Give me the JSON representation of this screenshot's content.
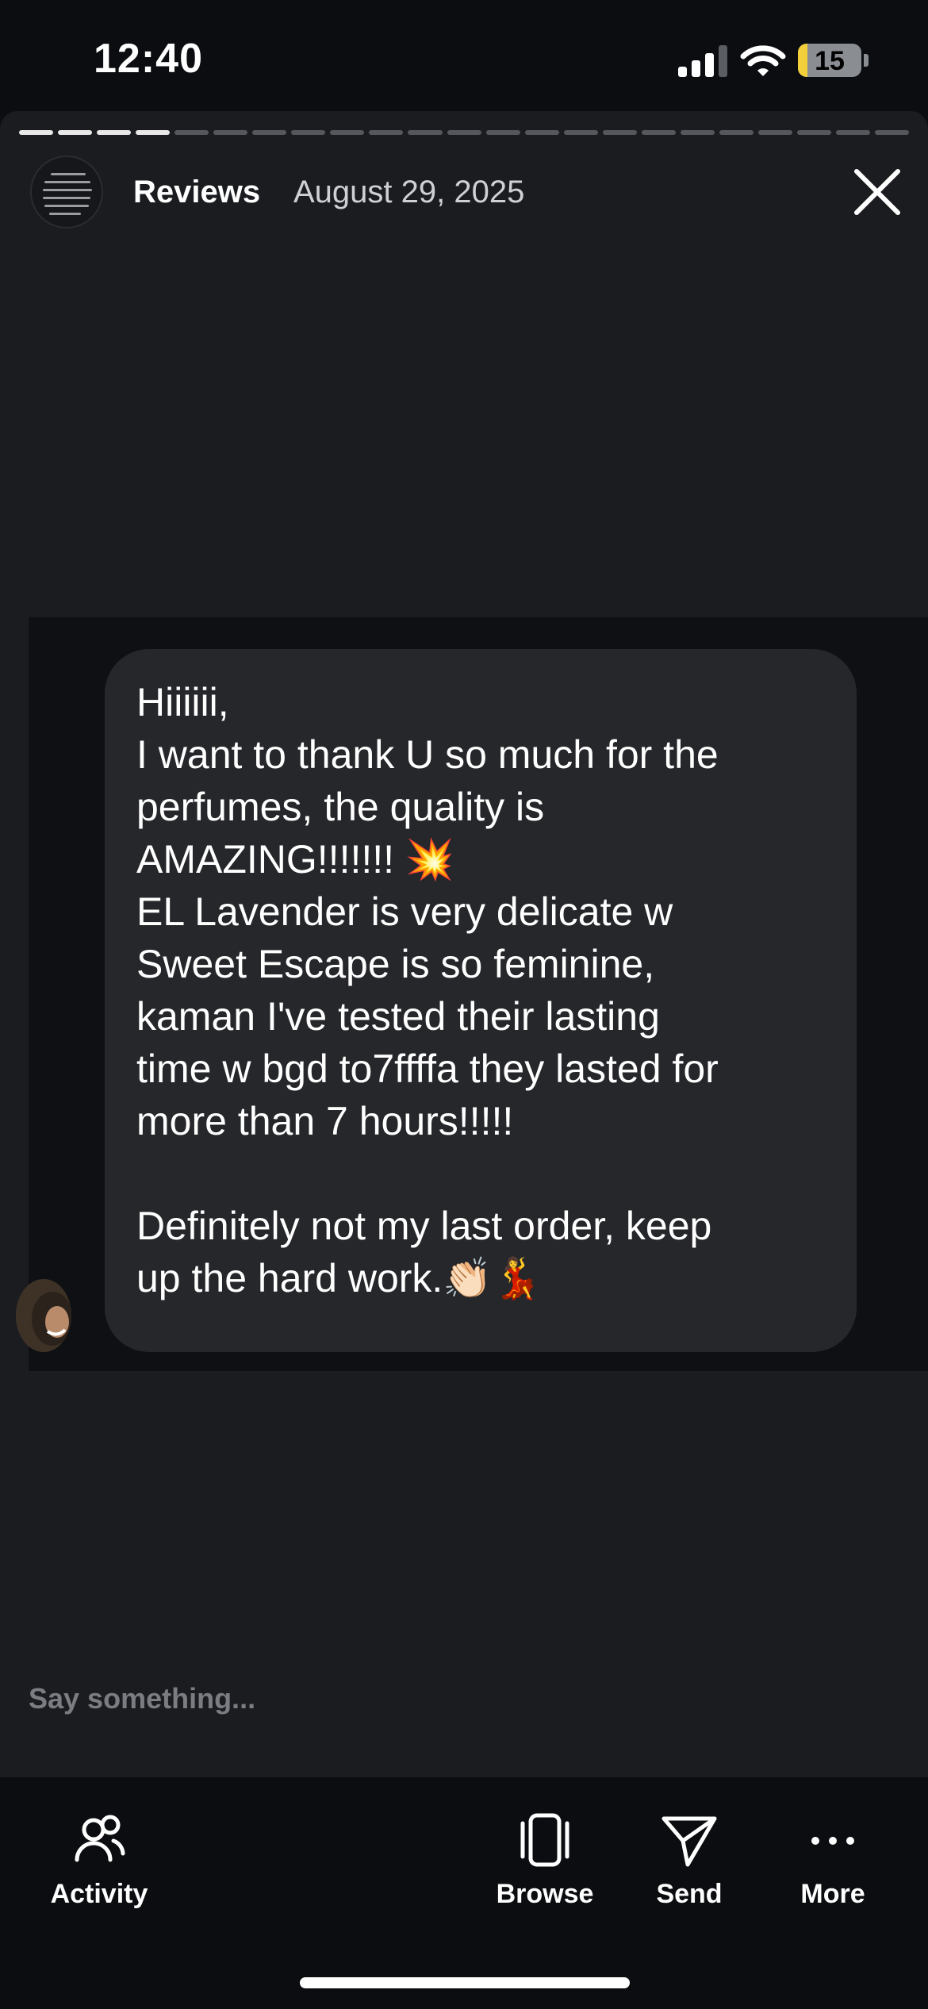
{
  "status_bar": {
    "time": "12:40",
    "battery_percent": "15",
    "battery_level": 0.15,
    "signal_bars_active": 3,
    "signal_bars_total": 4
  },
  "story": {
    "segments_total": 23,
    "segments_done": 4,
    "author": "Reviews",
    "date": "August 29, 2025"
  },
  "message": {
    "lines": [
      "Hiiiiii,",
      "I want to thank U so much for the",
      "perfumes, the quality is",
      "AMAZING!!!!!!! 💥",
      "EL Lavender is very delicate w",
      "Sweet Escape is so feminine,",
      "kaman I've tested their lasting",
      "time w bgd to7ffffa they lasted for",
      "more than 7 hours!!!!!",
      "",
      "Definitely not my last order, keep",
      "up the hard work.👏🏻💃"
    ]
  },
  "reply": {
    "placeholder": "Say something..."
  },
  "toolbar": {
    "activity": "Activity",
    "browse": "Browse",
    "send": "Send",
    "more": "More"
  },
  "colors": {
    "background": "#0b0d10",
    "story_bg": "#1b1c20",
    "bubble": "#26272b",
    "muted": "#7b7d82"
  }
}
